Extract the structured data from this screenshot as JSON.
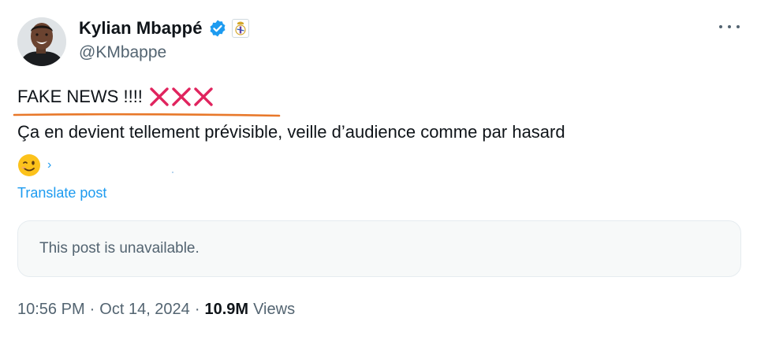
{
  "author": {
    "display_name": "Kylian Mbappé",
    "handle": "@KMbappe",
    "verified_color": "#1d9bf0",
    "affiliation_badge_icon": "real-madrid-crest-icon"
  },
  "menu": {
    "icon": "more-horizontal-icon"
  },
  "post": {
    "line1": "FAKE NEWS !!!!",
    "line1_marks": "❌❌❌",
    "line2": "Ça en devient tellement prévisible, veille d’audience comme par hasard",
    "emoji": "winking-face-emoji",
    "trailing_mark": "›"
  },
  "translate_label": "Translate post",
  "quoted": {
    "unavailable_text": "This post is unavailable."
  },
  "meta": {
    "time": "10:56 PM",
    "separator": "·",
    "date": "Oct 14, 2024",
    "views_count": "10.9M",
    "views_label": "Views"
  },
  "colors": {
    "accent": "#1d9bf0",
    "secondary_text": "#536471",
    "primary_text": "#0f1419",
    "x_mark": "#e0245e",
    "annotation_underline": "#e8782a"
  }
}
